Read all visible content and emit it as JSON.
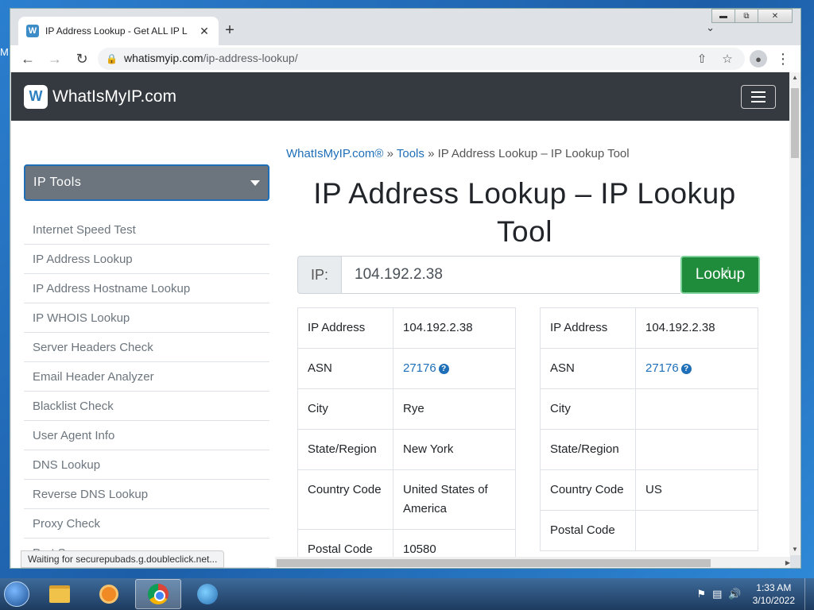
{
  "browser": {
    "tab_title": "IP Address Lookup - Get ALL IP L",
    "favicon": "W",
    "new_tab": "+",
    "tab_close": "✕",
    "url_host": "whatismyip.com",
    "url_path": "/ip-address-lookup/",
    "status_text": "Waiting for securepubads.g.doubleclick.net..."
  },
  "site": {
    "logo_text": "WhatIsMyIP.com",
    "logo_mark": "W"
  },
  "sidebar": {
    "dropdown_label": "IP Tools",
    "items": [
      "Internet Speed Test",
      "IP Address Lookup",
      "IP Address Hostname Lookup",
      "IP WHOIS Lookup",
      "Server Headers Check",
      "Email Header Analyzer",
      "Blacklist Check",
      "User Agent Info",
      "DNS Lookup",
      "Reverse DNS Lookup",
      "Proxy Check",
      "Port Scanner"
    ]
  },
  "main": {
    "breadcrumb": {
      "home": "WhatIsMyIP.com®",
      "sep1": " » ",
      "tools": "Tools",
      "sep2": " » ",
      "current": "IP Address Lookup – IP Lookup Tool"
    },
    "title": "IP Address Lookup – IP Lookup Tool",
    "ip_prefix": "IP:",
    "ip_value": "104.192.2.38",
    "lookup_label": "Lookup",
    "left_table": [
      {
        "key": "IP Address",
        "value": "104.192.2.38"
      },
      {
        "key": "ASN",
        "value": "27176",
        "link": true
      },
      {
        "key": "City",
        "value": "Rye"
      },
      {
        "key": "State/Region",
        "value": "New York"
      },
      {
        "key": "Country Code",
        "value": "United States of America"
      },
      {
        "key": "Postal Code",
        "value": "10580"
      }
    ],
    "right_table": [
      {
        "key": "IP Address",
        "value": "104.192.2.38"
      },
      {
        "key": "ASN",
        "value": "27176",
        "link": true
      },
      {
        "key": "City",
        "value": ""
      },
      {
        "key": "State/Region",
        "value": ""
      },
      {
        "key": "Country Code",
        "value": "US"
      },
      {
        "key": "Postal Code",
        "value": ""
      }
    ]
  },
  "taskbar": {
    "time": "1:33 AM",
    "date": "3/10/2022"
  },
  "desktop": {
    "edge_text": "M"
  }
}
